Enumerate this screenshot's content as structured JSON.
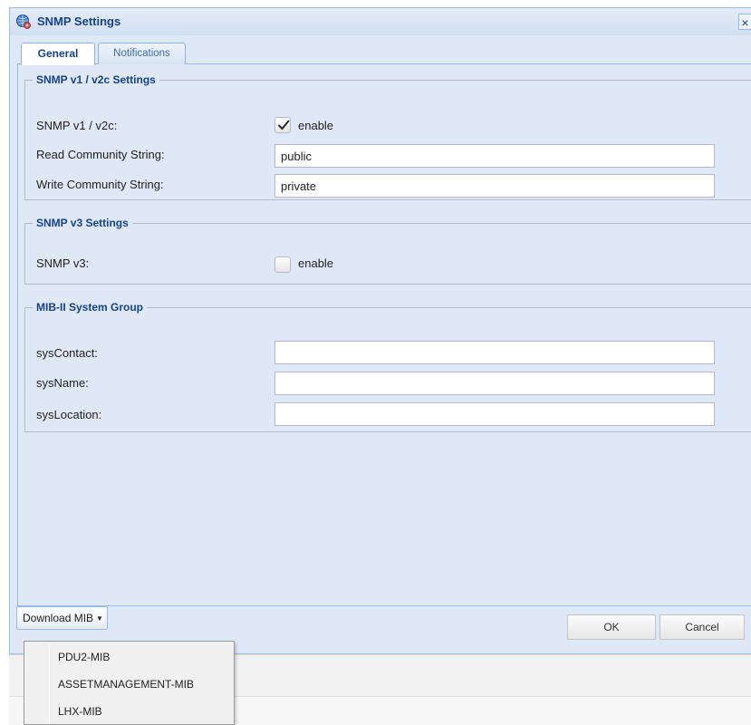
{
  "dialog": {
    "title": "SNMP Settings",
    "close_glyph": "×",
    "icon": "globe-gear-icon"
  },
  "tabs": [
    {
      "label": "General",
      "active": true
    },
    {
      "label": "Notifications",
      "active": false
    }
  ],
  "groups": {
    "v1": {
      "legend": "SNMP v1 / v2c Settings",
      "enable_label": "SNMP v1 / v2c:",
      "enable_checked": true,
      "checkbox_text": "enable",
      "read_label": "Read Community String:",
      "read_value": "public",
      "write_label": "Write Community String:",
      "write_value": "private"
    },
    "v3": {
      "legend": "SNMP v3 Settings",
      "enable_label": "SNMP v3:",
      "enable_checked": false,
      "checkbox_text": "enable"
    },
    "mib": {
      "legend": "MIB-II System Group",
      "contact_label": "sysContact:",
      "contact_value": "",
      "name_label": "sysName:",
      "name_value": "",
      "location_label": "sysLocation:",
      "location_value": ""
    }
  },
  "footer": {
    "download_label": "Download MIB",
    "caret": "▼",
    "ok_label": "OK",
    "cancel_label": "Cancel"
  },
  "dropdown_menu": {
    "items": [
      "PDU2-MIB",
      "ASSETMANAGEMENT-MIB",
      "LHX-MIB"
    ]
  },
  "colors": {
    "panel_bg": "#dfe8f6",
    "accent": "#15428b",
    "border": "#99bbe8"
  }
}
